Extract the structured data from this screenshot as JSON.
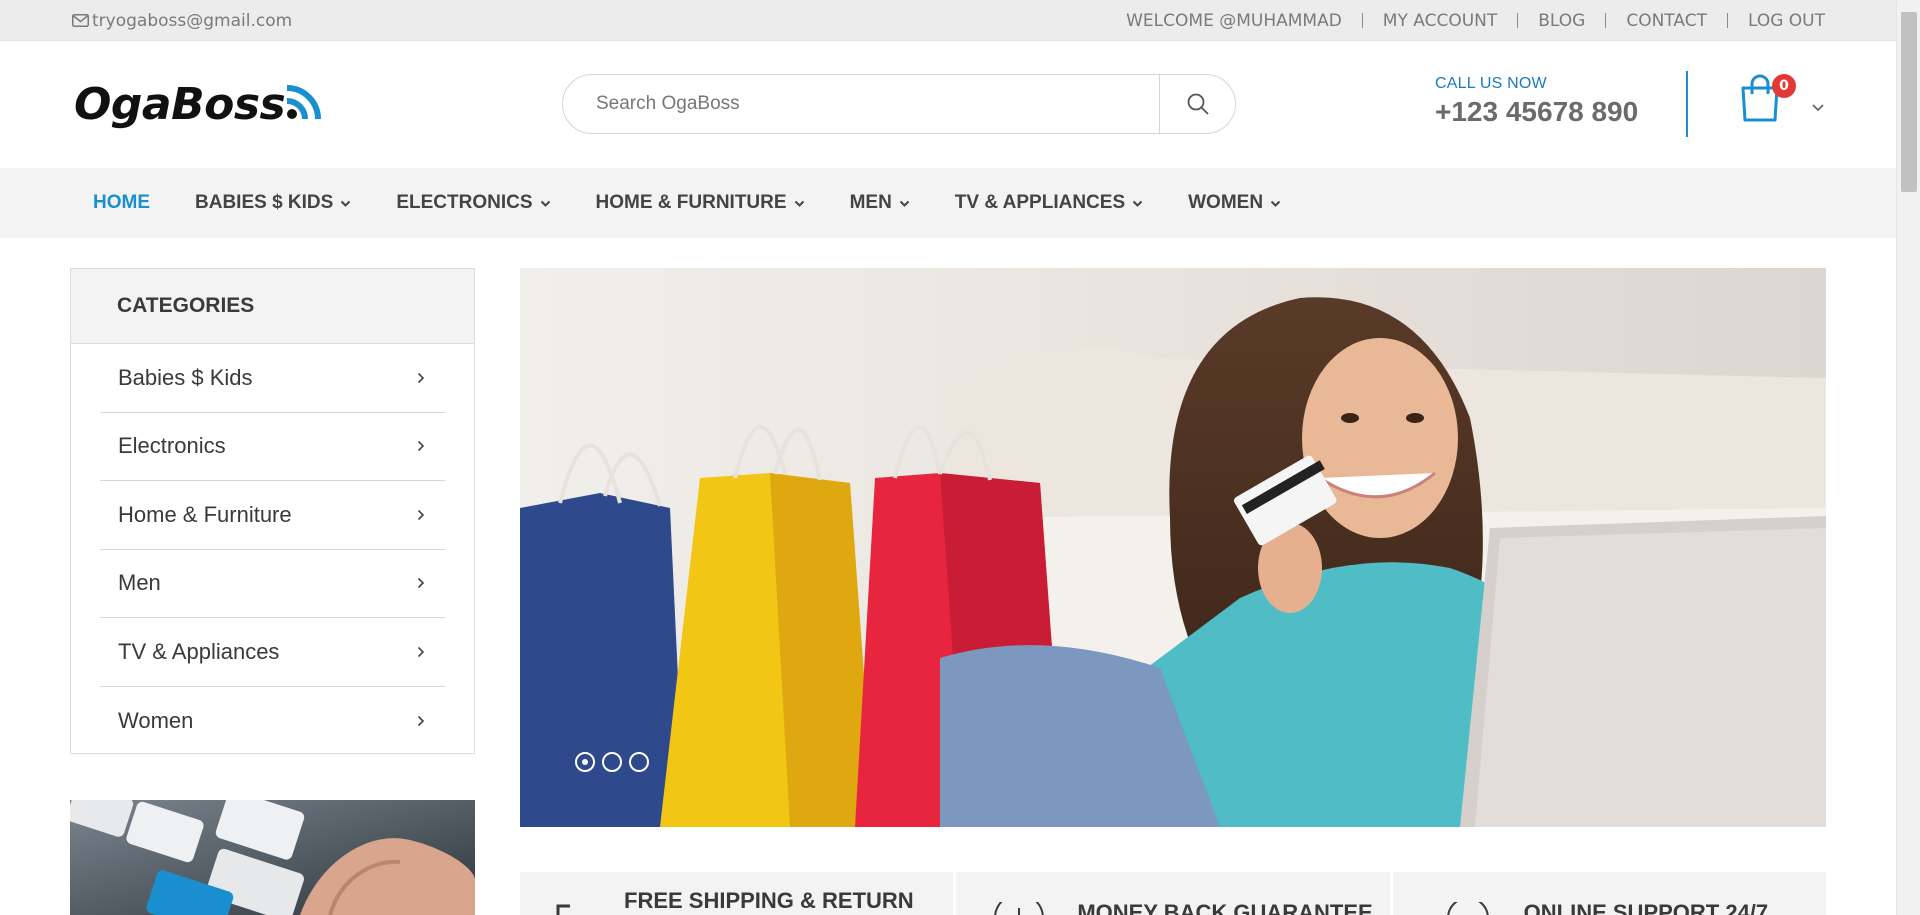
{
  "topbar": {
    "email": "tryogaboss@gmail.com",
    "links": [
      "WELCOME @MUHAMMAD",
      "MY ACCOUNT",
      "BLOG",
      "CONTACT",
      "LOG OUT"
    ]
  },
  "header": {
    "logo": "OgaBoss",
    "search_placeholder": "Search OgaBoss",
    "call_label": "CALL US NOW",
    "phone": "+123 45678 890",
    "cart_count": "0"
  },
  "nav": {
    "items": [
      "HOME",
      "BABIES $ KIDS",
      "ELECTRONICS",
      "HOME & FURNITURE",
      "MEN",
      "TV & APPLIANCES",
      "WOMEN"
    ]
  },
  "categories": {
    "title": "CATEGORIES",
    "items": [
      "Babies $ Kids",
      "Electronics",
      "Home & Furniture",
      "Men",
      "TV & Appliances",
      "Women"
    ]
  },
  "slider": {
    "slide_count": 3,
    "active_slide": 1
  },
  "features": [
    "FREE SHIPPING & RETURN",
    "MONEY BACK GUARANTEE",
    "ONLINE SUPPORT 24/7"
  ],
  "colors": {
    "accent": "#1a8fd0",
    "badge": "#e53935",
    "nav_bg": "#f3f3f3"
  },
  "icons": [
    "envelope-icon",
    "search-icon",
    "shopping-bag-icon",
    "chevron-down-icon",
    "chevron-right-icon",
    "rss-icon",
    "truck-icon",
    "money-icon",
    "support-icon"
  ]
}
